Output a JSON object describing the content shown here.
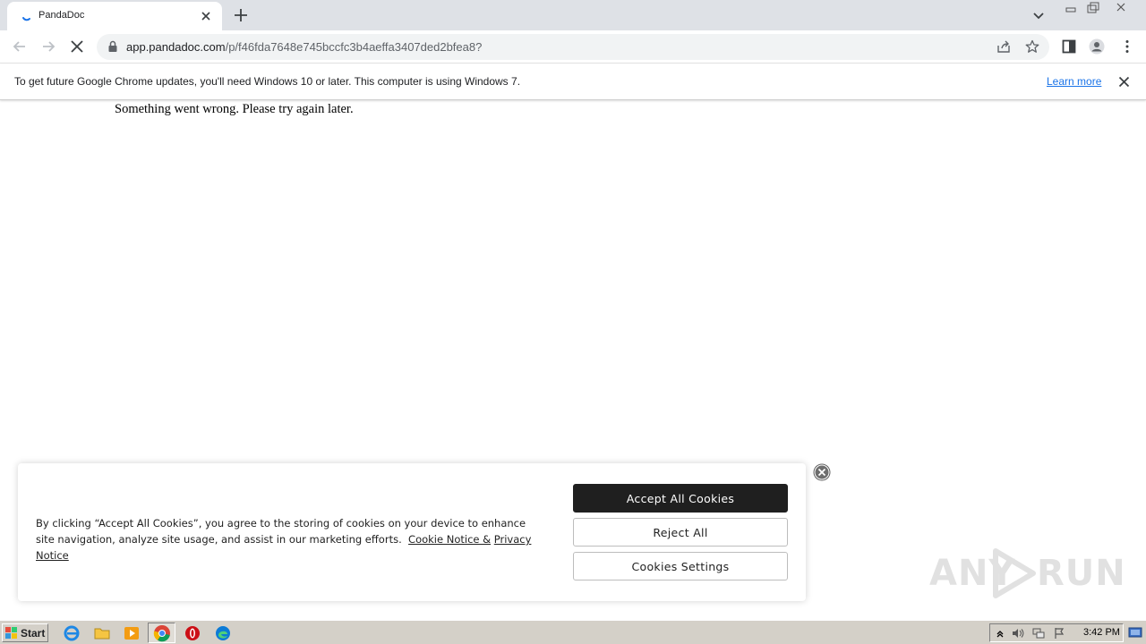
{
  "browser": {
    "tab_title": "PandaDoc",
    "url_host": "app.pandadoc.com",
    "url_path": "/p/f46fda7648e745bccfc3b4aeffa3407ded2bfea8?"
  },
  "infobar": {
    "message": "To get future Google Chrome updates, you'll need Windows 10 or later. This computer is using Windows 7.",
    "learn_more": "Learn more"
  },
  "page": {
    "error_message": "Something went wrong. Please try again later."
  },
  "cookie_banner": {
    "text": "By clicking “Accept All Cookies”, you agree to the storing of cookies on your device to enhance site navigation, analyze site usage, and assist in our marketing efforts.",
    "cookie_notice_link": "Cookie Notice &",
    "privacy_notice_link": "Privacy Notice",
    "accept_label": "Accept All Cookies",
    "reject_label": "Reject All",
    "settings_label": "Cookies Settings"
  },
  "watermark": {
    "left": "ANY",
    "right": "RUN"
  },
  "taskbar": {
    "start_label": "Start",
    "clock": "3:42 PM"
  },
  "colors": {
    "chrome_frame": "#dee1e6",
    "link_blue": "#1a73e8",
    "accept_button": "#1f1f1f",
    "taskbar": "#d4d0c8"
  }
}
